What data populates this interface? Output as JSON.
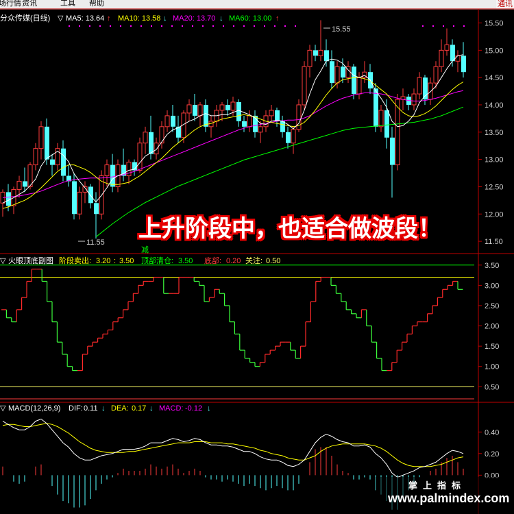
{
  "menubar": {
    "items": [
      "场行情",
      "资讯",
      "工具",
      "帮助"
    ],
    "corner": "通讯"
  },
  "price_panel": {
    "name": "分众传媒(日线)",
    "ma5": "MA5: 13.64",
    "ma10": "MA10: 13.58",
    "ma20": "MA20: 13.70",
    "ma60": "MA60: 13.00",
    "arrows": {
      "ma5": "↑",
      "ma10": "↓",
      "ma20": "↓",
      "ma60": "↑"
    },
    "high_label": "15.55",
    "low_label": "11.55",
    "marker_label": "减",
    "colors": {
      "up": "#ff3c3c",
      "down": "#54ffff",
      "ma5": "#ffffff",
      "ma10": "#ffff00",
      "ma20": "#ff00ff",
      "ma60": "#00ff00"
    }
  },
  "indicator_panel": {
    "name": "火眼顶底副图",
    "sell_label": "阶段卖出:",
    "sell_value_1": "3.20",
    "sell_sep": ":",
    "sell_value_2": "3.50",
    "clear_label": "顶部清仓:",
    "clear_value": "3.50",
    "bottom_label": "底部:",
    "bottom_value": "0.20",
    "watch_label": "关注:",
    "watch_value": "0.50"
  },
  "macd_panel": {
    "name": "MACD(12,26,9)",
    "dif_label": "DIF:",
    "dif_value": "0.11",
    "dif_arrow": "↓",
    "dea_label": "DEA:",
    "dea_value": "0.17",
    "dea_arrow": "↓",
    "macd_label": "MACD:",
    "macd_value": "-0.12",
    "macd_arrow": "↓"
  },
  "headline": "上升阶段中，也适合做波段！",
  "watermark": {
    "top": "掌上指标",
    "url": "www.palmindex.com"
  },
  "chart_data": [
    {
      "type": "candlestick",
      "title": "分众传媒(日线)",
      "y_ticks": [
        11.5,
        12.0,
        12.5,
        13.0,
        13.5,
        14.0,
        14.5,
        15.0,
        15.5
      ],
      "ylim": [
        11.3,
        15.72
      ],
      "ohlc": [
        [
          12.2,
          12.45,
          11.95,
          12.4
        ],
        [
          12.4,
          12.55,
          12.05,
          12.15
        ],
        [
          12.15,
          12.5,
          12.0,
          12.45
        ],
        [
          12.45,
          12.7,
          12.3,
          12.6
        ],
        [
          12.6,
          12.85,
          12.4,
          12.5
        ],
        [
          12.5,
          12.95,
          12.45,
          12.9
        ],
        [
          12.9,
          13.3,
          12.8,
          13.2
        ],
        [
          13.2,
          13.7,
          13.0,
          13.6
        ],
        [
          13.6,
          13.75,
          12.9,
          13.0
        ],
        [
          13.0,
          13.1,
          12.7,
          12.9
        ],
        [
          12.9,
          13.3,
          12.8,
          13.2
        ],
        [
          13.2,
          13.35,
          12.6,
          12.7
        ],
        [
          12.7,
          12.9,
          12.5,
          12.6
        ],
        [
          12.6,
          12.75,
          11.9,
          12.0
        ],
        [
          12.0,
          12.5,
          11.9,
          12.4
        ],
        [
          12.4,
          12.6,
          12.2,
          12.5
        ],
        [
          12.5,
          12.55,
          12.1,
          12.2
        ],
        [
          12.2,
          12.4,
          11.55,
          12.0
        ],
        [
          12.0,
          12.8,
          11.9,
          12.7
        ],
        [
          12.7,
          13.0,
          12.5,
          12.9
        ],
        [
          12.9,
          13.1,
          12.4,
          12.5
        ],
        [
          12.5,
          13.0,
          12.4,
          12.9
        ],
        [
          12.9,
          13.2,
          12.6,
          12.7
        ],
        [
          12.7,
          13.0,
          12.55,
          12.95
        ],
        [
          12.95,
          13.0,
          12.7,
          12.8
        ],
        [
          12.8,
          13.4,
          12.75,
          13.3
        ],
        [
          13.3,
          13.6,
          13.1,
          13.5
        ],
        [
          13.5,
          13.8,
          13.0,
          13.1
        ],
        [
          13.1,
          13.4,
          13.0,
          13.3
        ],
        [
          13.3,
          13.7,
          13.2,
          13.6
        ],
        [
          13.6,
          13.9,
          13.5,
          13.8
        ],
        [
          13.8,
          14.0,
          13.5,
          13.6
        ],
        [
          13.6,
          13.8,
          13.3,
          13.4
        ],
        [
          13.4,
          13.9,
          13.3,
          13.85
        ],
        [
          13.85,
          14.1,
          13.7,
          14.0
        ],
        [
          14.0,
          14.2,
          13.7,
          13.8
        ],
        [
          13.8,
          14.05,
          13.6,
          14.0
        ],
        [
          14.0,
          14.1,
          13.5,
          13.6
        ],
        [
          13.6,
          13.8,
          13.4,
          13.7
        ],
        [
          13.7,
          14.0,
          13.6,
          13.9
        ],
        [
          13.9,
          14.05,
          13.7,
          14.0
        ],
        [
          14.0,
          14.1,
          13.8,
          13.9
        ],
        [
          13.9,
          14.15,
          13.8,
          14.05
        ],
        [
          14.05,
          14.1,
          13.6,
          13.7
        ],
        [
          13.7,
          13.8,
          13.5,
          13.6
        ],
        [
          13.6,
          13.9,
          13.5,
          13.8
        ],
        [
          13.8,
          13.9,
          13.4,
          13.5
        ],
        [
          13.5,
          13.7,
          13.3,
          13.6
        ],
        [
          13.6,
          13.9,
          13.5,
          13.8
        ],
        [
          13.8,
          14.0,
          13.7,
          13.9
        ],
        [
          13.9,
          13.95,
          13.6,
          13.7
        ],
        [
          13.7,
          13.8,
          13.4,
          13.5
        ],
        [
          13.5,
          13.6,
          13.2,
          13.3
        ],
        [
          13.3,
          13.6,
          13.1,
          13.55
        ],
        [
          13.55,
          14.1,
          13.5,
          14.0
        ],
        [
          14.0,
          14.8,
          13.9,
          14.7
        ],
        [
          14.7,
          15.1,
          14.5,
          15.0
        ],
        [
          15.0,
          15.1,
          14.8,
          14.9
        ],
        [
          14.9,
          15.55,
          14.8,
          15.0
        ],
        [
          15.0,
          15.2,
          14.7,
          14.8
        ],
        [
          14.8,
          15.0,
          14.3,
          14.4
        ],
        [
          14.4,
          14.8,
          14.3,
          14.7
        ],
        [
          14.7,
          14.85,
          14.4,
          14.5
        ],
        [
          14.5,
          14.8,
          14.4,
          14.7
        ],
        [
          14.7,
          14.75,
          14.1,
          14.2
        ],
        [
          14.2,
          14.6,
          14.1,
          14.5
        ],
        [
          14.5,
          14.8,
          14.4,
          14.6
        ],
        [
          14.6,
          14.75,
          14.2,
          14.3
        ],
        [
          14.3,
          14.4,
          13.5,
          13.6
        ],
        [
          13.6,
          14.0,
          13.5,
          13.9
        ],
        [
          13.9,
          14.1,
          13.2,
          13.4
        ],
        [
          13.4,
          13.6,
          12.3,
          12.9
        ],
        [
          12.9,
          14.2,
          12.8,
          14.1
        ],
        [
          14.1,
          14.3,
          13.9,
          14.15
        ],
        [
          14.15,
          14.2,
          13.9,
          14.0
        ],
        [
          14.0,
          14.3,
          13.9,
          14.2
        ],
        [
          14.2,
          14.6,
          14.1,
          14.5
        ],
        [
          14.5,
          14.55,
          14.0,
          14.1
        ],
        [
          14.1,
          14.5,
          14.0,
          14.4
        ],
        [
          14.4,
          14.8,
          14.3,
          14.7
        ],
        [
          14.7,
          15.2,
          14.6,
          15.0
        ],
        [
          15.0,
          15.4,
          14.9,
          15.1
        ],
        [
          15.1,
          15.2,
          14.7,
          14.8
        ],
        [
          14.8,
          15.0,
          14.6,
          14.9
        ],
        [
          14.9,
          15.15,
          14.5,
          14.6
        ]
      ],
      "ma5": [
        12.2,
        12.25,
        12.3,
        12.36,
        12.42,
        12.52,
        12.64,
        12.88,
        13.02,
        13.08,
        13.15,
        13.08,
        12.96,
        12.74,
        12.6,
        12.48,
        12.34,
        12.22,
        12.34,
        12.48,
        12.64,
        12.7,
        12.74,
        12.8,
        12.82,
        12.94,
        13.06,
        13.12,
        13.18,
        13.32,
        13.46,
        13.54,
        13.58,
        13.64,
        13.7,
        13.74,
        13.8,
        13.84,
        13.8,
        13.8,
        13.82,
        13.82,
        13.86,
        13.9,
        13.86,
        13.82,
        13.76,
        13.66,
        13.64,
        13.7,
        13.72,
        13.7,
        13.64,
        13.56,
        13.66,
        13.9,
        14.2,
        14.46,
        14.62,
        14.8,
        14.84,
        14.82,
        14.76,
        14.64,
        14.54,
        14.5,
        14.54,
        14.46,
        14.26,
        14.12,
        13.96,
        13.7,
        13.6,
        13.62,
        13.7,
        13.82,
        14.04,
        14.16,
        14.24,
        14.34,
        14.5,
        14.66,
        14.8,
        14.9,
        14.92
      ],
      "ma10": [
        12.1,
        12.13,
        12.17,
        12.21,
        12.25,
        12.31,
        12.39,
        12.48,
        12.58,
        12.68,
        12.78,
        12.85,
        12.9,
        12.9,
        12.86,
        12.82,
        12.76,
        12.68,
        12.6,
        12.56,
        12.54,
        12.54,
        12.56,
        12.58,
        12.64,
        12.7,
        12.78,
        12.86,
        12.94,
        13.02,
        13.12,
        13.22,
        13.3,
        13.38,
        13.46,
        13.54,
        13.6,
        13.64,
        13.66,
        13.7,
        13.74,
        13.76,
        13.78,
        13.8,
        13.82,
        13.8,
        13.78,
        13.74,
        13.7,
        13.68,
        13.66,
        13.64,
        13.62,
        13.6,
        13.62,
        13.68,
        13.78,
        13.9,
        14.04,
        14.18,
        14.3,
        14.4,
        14.46,
        14.48,
        14.5,
        14.5,
        14.48,
        14.44,
        14.36,
        14.28,
        14.2,
        14.08,
        13.96,
        13.86,
        13.8,
        13.78,
        13.8,
        13.84,
        13.9,
        13.98,
        14.08,
        14.18,
        14.28,
        14.36,
        14.42
      ],
      "ma20": [
        12.3,
        12.31,
        12.32,
        12.33,
        12.35,
        12.37,
        12.39,
        12.42,
        12.46,
        12.5,
        12.54,
        12.58,
        12.61,
        12.63,
        12.64,
        12.65,
        12.66,
        12.66,
        12.66,
        12.67,
        12.68,
        12.7,
        12.72,
        12.75,
        12.78,
        12.82,
        12.86,
        12.9,
        12.94,
        12.98,
        13.02,
        13.06,
        13.1,
        13.14,
        13.18,
        13.22,
        13.26,
        13.3,
        13.34,
        13.38,
        13.42,
        13.46,
        13.5,
        13.54,
        13.57,
        13.6,
        13.62,
        13.64,
        13.66,
        13.68,
        13.7,
        13.71,
        13.72,
        13.72,
        13.73,
        13.76,
        13.8,
        13.86,
        13.92,
        13.98,
        14.03,
        14.08,
        14.12,
        14.15,
        14.18,
        14.2,
        14.22,
        14.22,
        14.21,
        14.2,
        14.18,
        14.15,
        14.12,
        14.1,
        14.08,
        14.07,
        14.07,
        14.08,
        14.1,
        14.12,
        14.15,
        14.18,
        14.21,
        14.24,
        14.26
      ],
      "ma60_start_index": 17,
      "ma60": [
        11.58,
        11.66,
        11.74,
        11.82,
        11.89,
        11.96,
        12.03,
        12.09,
        12.15,
        12.21,
        12.26,
        12.31,
        12.36,
        12.41,
        12.46,
        12.51,
        12.55,
        12.59,
        12.63,
        12.67,
        12.71,
        12.75,
        12.79,
        12.83,
        12.87,
        12.91,
        12.95,
        12.99,
        13.02,
        13.05,
        13.08,
        13.11,
        13.14,
        13.17,
        13.2,
        13.23,
        13.26,
        13.29,
        13.32,
        13.35,
        13.38,
        13.41,
        13.44,
        13.47,
        13.5,
        13.53,
        13.55,
        13.57,
        13.58,
        13.59,
        13.6,
        13.61,
        13.62,
        13.63,
        13.64,
        13.65,
        13.66,
        13.67,
        13.68,
        13.7,
        13.72,
        13.74,
        13.77,
        13.8,
        13.84,
        13.88,
        13.92,
        13.96
      ]
    },
    {
      "type": "step",
      "title": "火眼顶底副图",
      "y_ticks": [
        0.5,
        1.0,
        1.5,
        2.0,
        2.5,
        3.0,
        3.5
      ],
      "ylim": [
        0.15,
        3.75
      ],
      "reference_lines": [
        3.2,
        3.5,
        0.2,
        0.5
      ],
      "values": [
        2.4,
        2.2,
        2.1,
        2.4,
        2.7,
        3.1,
        3.4,
        3.4,
        3.1,
        2.6,
        2.1,
        1.6,
        1.3,
        1.0,
        0.9,
        0.9,
        1.3,
        1.5,
        1.6,
        1.7,
        1.8,
        1.9,
        2.1,
        2.2,
        2.4,
        2.6,
        2.8,
        3.0,
        3.1,
        3.1,
        3.2,
        3.2,
        2.8,
        2.8,
        2.8,
        3.2,
        3.2,
        3.2,
        3.1,
        3.0,
        2.6,
        2.7,
        2.9,
        2.8,
        2.5,
        2.1,
        1.8,
        1.4,
        1.2,
        1.1,
        1.0,
        1.1,
        1.3,
        1.4,
        1.5,
        1.6,
        1.6,
        1.4,
        1.2,
        1.5,
        2.1,
        2.6,
        3.1,
        3.2,
        3.2,
        3.0,
        2.8,
        2.6,
        2.4,
        2.3,
        2.2,
        2.4,
        2.0,
        1.6,
        1.2,
        0.9,
        0.9,
        1.1,
        1.4,
        1.6,
        1.8,
        2.0,
        2.1,
        2.1,
        2.3,
        2.5,
        2.7,
        2.9,
        3.0,
        3.1,
        2.9
      ]
    },
    {
      "type": "macd",
      "title": "MACD(12,26,9)",
      "y_ticks": [
        0.0,
        0.2,
        0.4
      ],
      "ylim": [
        -0.36,
        0.58
      ],
      "dif": [
        0.5,
        0.47,
        0.44,
        0.42,
        0.42,
        0.45,
        0.5,
        0.52,
        0.48,
        0.42,
        0.36,
        0.3,
        0.26,
        0.2,
        0.16,
        0.14,
        0.14,
        0.16,
        0.18,
        0.19,
        0.2,
        0.22,
        0.24,
        0.24,
        0.24,
        0.25,
        0.27,
        0.3,
        0.3,
        0.3,
        0.32,
        0.34,
        0.33,
        0.31,
        0.32,
        0.34,
        0.33,
        0.3,
        0.28,
        0.28,
        0.27,
        0.27,
        0.26,
        0.24,
        0.22,
        0.22,
        0.2,
        0.17,
        0.15,
        0.14,
        0.14,
        0.12,
        0.09,
        0.08,
        0.1,
        0.14,
        0.22,
        0.3,
        0.35,
        0.38,
        0.36,
        0.33,
        0.31,
        0.3,
        0.27,
        0.27,
        0.28,
        0.26,
        0.2,
        0.16,
        0.1,
        0.02,
        -0.02,
        0.0,
        0.02,
        0.04,
        0.07,
        0.08,
        0.1,
        0.12,
        0.16,
        0.2,
        0.23,
        0.22,
        0.2
      ],
      "dea": [
        0.46,
        0.47,
        0.47,
        0.46,
        0.45,
        0.45,
        0.46,
        0.47,
        0.48,
        0.47,
        0.45,
        0.42,
        0.39,
        0.35,
        0.31,
        0.28,
        0.25,
        0.23,
        0.22,
        0.21,
        0.21,
        0.21,
        0.21,
        0.22,
        0.22,
        0.23,
        0.24,
        0.25,
        0.26,
        0.27,
        0.28,
        0.29,
        0.3,
        0.3,
        0.3,
        0.31,
        0.31,
        0.31,
        0.3,
        0.3,
        0.3,
        0.29,
        0.29,
        0.28,
        0.27,
        0.26,
        0.25,
        0.23,
        0.22,
        0.2,
        0.19,
        0.18,
        0.16,
        0.15,
        0.14,
        0.14,
        0.16,
        0.18,
        0.22,
        0.25,
        0.27,
        0.28,
        0.29,
        0.29,
        0.29,
        0.29,
        0.29,
        0.28,
        0.27,
        0.25,
        0.22,
        0.18,
        0.14,
        0.11,
        0.09,
        0.08,
        0.08,
        0.08,
        0.08,
        0.09,
        0.1,
        0.12,
        0.14,
        0.16,
        0.17
      ],
      "macd": [
        0.08,
        0.0,
        -0.06,
        -0.08,
        -0.06,
        0.0,
        0.08,
        0.1,
        0.0,
        -0.1,
        -0.18,
        -0.24,
        -0.26,
        -0.3,
        -0.3,
        -0.28,
        -0.22,
        -0.14,
        -0.08,
        -0.04,
        -0.02,
        0.02,
        0.06,
        0.04,
        0.04,
        0.04,
        0.06,
        0.1,
        0.08,
        0.06,
        0.08,
        0.1,
        0.06,
        0.02,
        0.04,
        0.06,
        0.04,
        -0.02,
        -0.04,
        -0.04,
        -0.06,
        -0.04,
        -0.06,
        -0.08,
        -0.1,
        -0.08,
        -0.1,
        -0.12,
        -0.14,
        -0.12,
        -0.1,
        -0.12,
        -0.14,
        -0.14,
        -0.08,
        0.0,
        0.12,
        0.24,
        0.26,
        0.26,
        0.18,
        0.1,
        0.04,
        0.02,
        -0.04,
        -0.04,
        -0.02,
        -0.04,
        -0.14,
        -0.18,
        -0.24,
        -0.32,
        -0.32,
        -0.22,
        -0.14,
        -0.08,
        -0.02,
        0.0,
        0.04,
        0.06,
        0.12,
        0.16,
        0.18,
        0.12,
        0.06
      ]
    }
  ]
}
